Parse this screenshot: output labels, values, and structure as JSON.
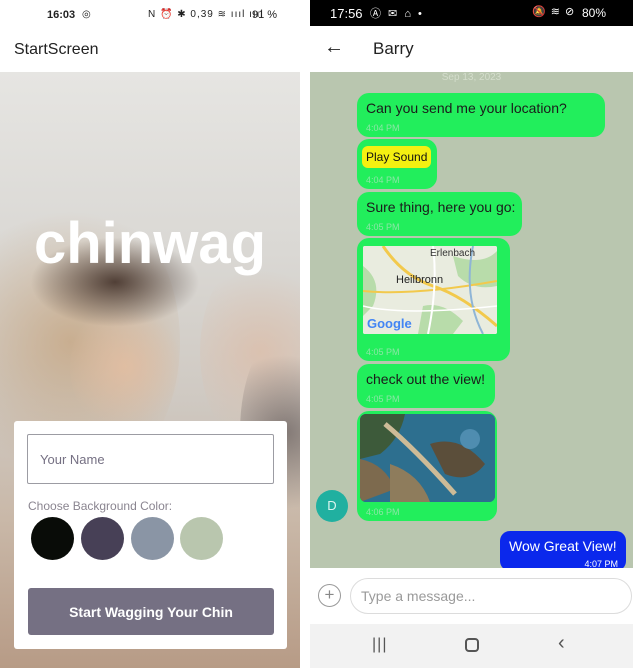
{
  "start_screen": {
    "status_bar": {
      "time": "16:03",
      "whatsapp_icon": "whatsapp-icon",
      "system_icons": "N ⏰ ✱ 0,39 ≋ ıııl ıııl",
      "battery": "91 %"
    },
    "app_bar_title": "StartScreen",
    "hero_title": "chinwag",
    "name_input_placeholder": "Your Name",
    "bg_color_label": "Choose Background Color:",
    "background_colors": [
      "#090C08",
      "#474056",
      "#8A95A5",
      "#B9C6AE"
    ],
    "start_button_label": "Start Wagging Your Chin"
  },
  "chat_screen": {
    "status_bar": {
      "time": "17:56",
      "left_icons": "Ⓐ ✉ ⌂ •",
      "right_icons": "🔕 ≋ ⊘",
      "battery": "80%"
    },
    "title": "Barry",
    "date_separator": "Sep 13, 2023",
    "messages": [
      {
        "text": "Can you send me your location?",
        "time": "4:04 PM"
      },
      {
        "sound_label": "Play Sound",
        "time": "4:04 PM"
      },
      {
        "text": "Sure thing, here you go:",
        "time": "4:05 PM"
      },
      {
        "map_labels": [
          "Erlenbach",
          "Heilbronn",
          "Google"
        ],
        "time": "4:05 PM"
      },
      {
        "text": "check out the view!",
        "time": "4:05 PM"
      },
      {
        "image": "coastal-view-photo",
        "time": "4:06 PM"
      }
    ],
    "avatar_initial": "D",
    "outgoing": {
      "text": "Wow Great View!",
      "time": "4:07 PM"
    },
    "composer_placeholder": "Type a message...",
    "accent_color": "#22ee5c",
    "outgoing_color": "#0b28ec"
  }
}
